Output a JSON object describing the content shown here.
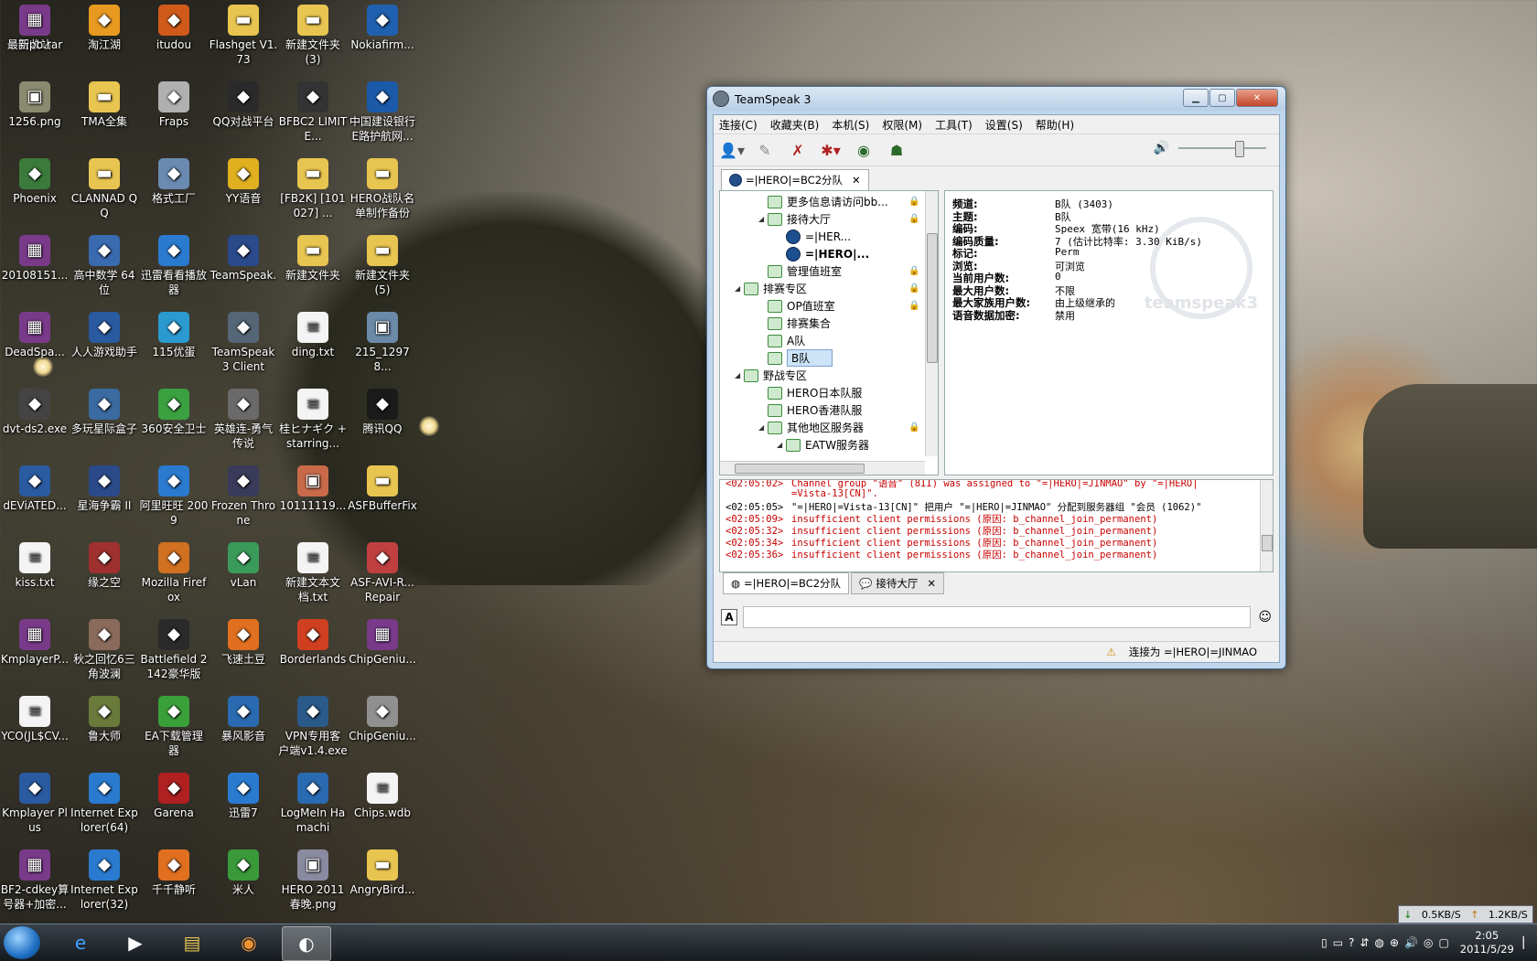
{
  "desktop_icons": [
    {
      "label": "回收站",
      "icon": "recycle-bin-icon",
      "color": "#8a9aa8"
    },
    {
      "label": "淘江湖",
      "icon": "app-icon",
      "color": "#e89a20"
    },
    {
      "label": "itudou",
      "icon": "app-icon",
      "color": "#d05a1a"
    },
    {
      "label": "Flashget V1.73",
      "icon": "folder-icon",
      "color": "#e8c550"
    },
    {
      "label": "新建文件夹 (3)",
      "icon": "folder-icon",
      "color": "#e8c550"
    },
    {
      "label": "Nokiafirm...",
      "icon": "app-icon",
      "color": "#2060b0"
    },
    {
      "label": "1256.png",
      "icon": "image-icon",
      "color": "#8a8a70"
    },
    {
      "label": "TMA全集",
      "icon": "folder-icon",
      "color": "#e8c550"
    },
    {
      "label": "Fraps",
      "icon": "app-icon",
      "color": "#b0b0b0"
    },
    {
      "label": "QQ对战平台",
      "icon": "app-icon",
      "color": "#2a2a2a"
    },
    {
      "label": "BFBC2 LIMITE...",
      "icon": "app-icon",
      "color": "#333"
    },
    {
      "label": "中国建设银行 E路护航网...",
      "icon": "app-icon",
      "color": "#1a5aa8"
    },
    {
      "label": "Phoenix",
      "icon": "app-icon",
      "color": "#3a7a3a"
    },
    {
      "label": "CLANNAD QQ",
      "icon": "folder-icon",
      "color": "#e8c550"
    },
    {
      "label": "格式工厂",
      "icon": "app-icon",
      "color": "#6a8ab0"
    },
    {
      "label": "YY语音",
      "icon": "app-icon",
      "color": "#e0b020"
    },
    {
      "label": "[FB2K] [101027] ...",
      "icon": "folder-icon",
      "color": "#e8c550"
    },
    {
      "label": "HERO战队名 单制作备份",
      "icon": "folder-icon",
      "color": "#e8c550"
    },
    {
      "label": "20108151...",
      "icon": "archive-icon",
      "color": "#7a3a8a"
    },
    {
      "label": "高中数学 64 位",
      "icon": "app-icon",
      "color": "#3a6ab0"
    },
    {
      "label": "迅雷看看播放 器",
      "icon": "app-icon",
      "color": "#2a7ad0"
    },
    {
      "label": "TeamSpeak.",
      "icon": "app-icon",
      "color": "#2a4a8a"
    },
    {
      "label": "新建文件夹",
      "icon": "folder-icon",
      "color": "#e8c550"
    },
    {
      "label": "新建文件夹 (5)",
      "icon": "folder-icon",
      "color": "#e8c550"
    },
    {
      "label": "DeadSpa...",
      "icon": "archive-icon",
      "color": "#7a3a8a"
    },
    {
      "label": "人人游戏助手",
      "icon": "app-icon",
      "color": "#2a5aa0"
    },
    {
      "label": "115优蛋",
      "icon": "app-icon",
      "color": "#2a9ad0"
    },
    {
      "label": "TeamSpeak 3 Client",
      "icon": "app-icon",
      "color": "#556677"
    },
    {
      "label": "ding.txt",
      "icon": "text-file-icon",
      "color": "#f4f4f4"
    },
    {
      "label": "215_12978...",
      "icon": "image-icon",
      "color": "#6a8aa8"
    },
    {
      "label": "dvt-ds2.exe",
      "icon": "app-icon",
      "color": "#444"
    },
    {
      "label": "多玩星际盒子",
      "icon": "app-icon",
      "color": "#3a6aa0"
    },
    {
      "label": "360安全卫士",
      "icon": "app-icon",
      "color": "#3aa040"
    },
    {
      "label": "英雄连-勇气 传说",
      "icon": "app-icon",
      "color": "#6a6a6a"
    },
    {
      "label": "桂ヒナギク +starring...",
      "icon": "text-file-icon",
      "color": "#f4f4f4"
    },
    {
      "label": "腾讯QQ",
      "icon": "app-icon",
      "color": "#1a1a1a"
    },
    {
      "label": "dEViATED...",
      "icon": "app-icon",
      "color": "#2a5aa0"
    },
    {
      "label": "星海争霸 II",
      "icon": "app-icon",
      "color": "#2a4a8a"
    },
    {
      "label": "阿里旺旺 2009",
      "icon": "app-icon",
      "color": "#2a7ad0"
    },
    {
      "label": "Frozen Throne",
      "icon": "app-icon",
      "color": "#3a3a5a"
    },
    {
      "label": "10111119...",
      "icon": "image-icon",
      "color": "#c86a4a"
    },
    {
      "label": "ASFBufferFix",
      "icon": "folder-icon",
      "color": "#e8c550"
    },
    {
      "label": "kiss.txt",
      "icon": "text-file-icon",
      "color": "#f4f4f4"
    },
    {
      "label": "缘之空",
      "icon": "app-icon",
      "color": "#a03030"
    },
    {
      "label": "Mozilla Firefox",
      "icon": "app-icon",
      "color": "#d07020"
    },
    {
      "label": "vLan",
      "icon": "app-icon",
      "color": "#3a9a5a"
    },
    {
      "label": "新建文本文 档.txt",
      "icon": "text-file-icon",
      "color": "#f4f4f4"
    },
    {
      "label": "ASF-AVI-R... Repair",
      "icon": "app-icon",
      "color": "#c04040"
    },
    {
      "label": "KmplayerP...",
      "icon": "archive-icon",
      "color": "#7a3a8a"
    },
    {
      "label": "秋之回忆6三 角波澜",
      "icon": "app-icon",
      "color": "#8a6a5a"
    },
    {
      "label": "Battlefield 2142豪华版",
      "icon": "app-icon",
      "color": "#2a2a2a"
    },
    {
      "label": "飞速土豆",
      "icon": "app-icon",
      "color": "#e07020"
    },
    {
      "label": "Borderlands",
      "icon": "app-icon",
      "color": "#d04020"
    },
    {
      "label": "ChipGeniu...",
      "icon": "archive-icon",
      "color": "#7a3a8a"
    },
    {
      "label": "YCO(JL$CV...",
      "icon": "text-file-icon",
      "color": "#f4f4f4"
    },
    {
      "label": "鲁大师",
      "icon": "app-icon",
      "color": "#6a7a3a"
    },
    {
      "label": "EA下载管理 器",
      "icon": "app-icon",
      "color": "#3aa03a"
    },
    {
      "label": "暴风影音",
      "icon": "app-icon",
      "color": "#2a6ab0"
    },
    {
      "label": "VPN专用客 户端v1.4.exe",
      "icon": "app-icon",
      "color": "#2a5a8a"
    },
    {
      "label": "ChipGeniu...",
      "icon": "app-icon",
      "color": "#909090"
    },
    {
      "label": "Kmplayer Plus",
      "icon": "app-icon",
      "color": "#2a5aa0"
    },
    {
      "label": "Internet Explorer(64)",
      "icon": "app-icon",
      "color": "#2a7ad0"
    },
    {
      "label": "Garena",
      "icon": "app-icon",
      "color": "#b02020"
    },
    {
      "label": "迅雷7",
      "icon": "app-icon",
      "color": "#2a7ad0"
    },
    {
      "label": "LogMeIn Hamachi",
      "icon": "app-icon",
      "color": "#2a6ab0"
    },
    {
      "label": "Chips.wdb",
      "icon": "text-file-icon",
      "color": "#f4f4f4"
    },
    {
      "label": "BF2-cdkey算 号器+加密...",
      "icon": "archive-icon",
      "color": "#7a3a8a"
    },
    {
      "label": "Internet Explorer(32)",
      "icon": "app-icon",
      "color": "#2a7ad0"
    },
    {
      "label": "千千静听",
      "icon": "app-icon",
      "color": "#e07020"
    },
    {
      "label": "米人",
      "icon": "app-icon",
      "color": "#3a9a3a"
    },
    {
      "label": "HERO 2011 春晚.png",
      "icon": "image-icon",
      "color": "#8a8aa0"
    },
    {
      "label": "AngryBird...",
      "icon": "folder-icon",
      "color": "#e8c550"
    },
    {
      "label": "最新pb.rar",
      "icon": "archive-icon",
      "color": "#7a3a8a"
    }
  ],
  "ts": {
    "title": "TeamSpeak 3",
    "menu": [
      "连接(C)",
      "收藏夹(B)",
      "本机(S)",
      "权限(M)",
      "工具(T)",
      "设置(S)",
      "帮助(H)"
    ],
    "server_tab": "=|HERO|=BC2分队",
    "tree": [
      {
        "label": "更多信息请访问bb...",
        "kind": "channel",
        "lock": true
      },
      {
        "label": "接待大厅",
        "kind": "channel",
        "lock": true
      },
      {
        "label": "=|HER...",
        "kind": "user"
      },
      {
        "label": "=|HERO|...",
        "kind": "user"
      },
      {
        "label": "管理值班室",
        "kind": "channel",
        "lock": true
      },
      {
        "label": "排赛专区",
        "kind": "channel",
        "lock": true
      },
      {
        "label": "OP值班室",
        "kind": "channel",
        "lock": true
      },
      {
        "label": "排赛集合",
        "kind": "channel"
      },
      {
        "label": "A队",
        "kind": "channel"
      },
      {
        "label": "B队",
        "kind": "channel",
        "selected": true
      },
      {
        "label": "野战专区",
        "kind": "channel"
      },
      {
        "label": "HERO日本队服",
        "kind": "channel"
      },
      {
        "label": "HERO香港队服",
        "kind": "channel"
      },
      {
        "label": "其他地区服务器",
        "kind": "channel",
        "lock": true
      },
      {
        "label": "EATW服务器",
        "kind": "channel"
      }
    ],
    "info": [
      {
        "k": "频道:",
        "v": "B队 (3403)"
      },
      {
        "k": "主题:",
        "v": "B队"
      },
      {
        "k": "编码:",
        "v": "Speex 宽带(16 kHz)"
      },
      {
        "k": "编码质量:",
        "v": "7 (估计比特率: 3.30 KiB/s)"
      },
      {
        "k": "标记:",
        "v": "Perm"
      },
      {
        "k": "浏览:",
        "v": "可浏览"
      },
      {
        "k": "当前用户数:",
        "v": "0"
      },
      {
        "k": "最大用户数:",
        "v": "不限"
      },
      {
        "k": "最大家族用户数:",
        "v": "由上级继承的"
      },
      {
        "k": "语音数据加密:",
        "v": "禁用"
      }
    ],
    "watermark": "teamspeak3",
    "log": [
      {
        "t": "<02:05:02>",
        "m": "Channel group \"语音\" (8II) was assigned to \"=|HERO|=JINMAO\" by \"=|HERO|",
        "red": true
      },
      {
        "t": "",
        "m": "=Vista-13[CN]\".",
        "red": true
      },
      {
        "t": "<02:05:05>",
        "m": "\"=|HERO|=Vista-13[CN]\" 把用户 \"=|HERO|=JINMAO\" 分配到服务器组 \"会员 (1062)\"",
        "red": false
      },
      {
        "t": "<02:05:09>",
        "m": "insufficient client permissions (原因: b_channel_join_permanent)",
        "red": true
      },
      {
        "t": "<02:05:32>",
        "m": "insufficient client permissions (原因: b_channel_join_permanent)",
        "red": true
      },
      {
        "t": "<02:05:34>",
        "m": "insufficient client permissions (原因: b_channel_join_permanent)",
        "red": true
      },
      {
        "t": "<02:05:36>",
        "m": "insufficient client permissions (原因: b_channel_join_permanent)",
        "red": true
      }
    ],
    "chat_tabs": [
      "=|HERO|=BC2分队",
      "接待大厅"
    ],
    "status": "连接为 =|HERO|=JINMAO"
  },
  "taskbar": {
    "net_down": "0.5KB/S",
    "net_up": "1.2KB/S",
    "time": "2:05",
    "date": "2011/5/29"
  }
}
